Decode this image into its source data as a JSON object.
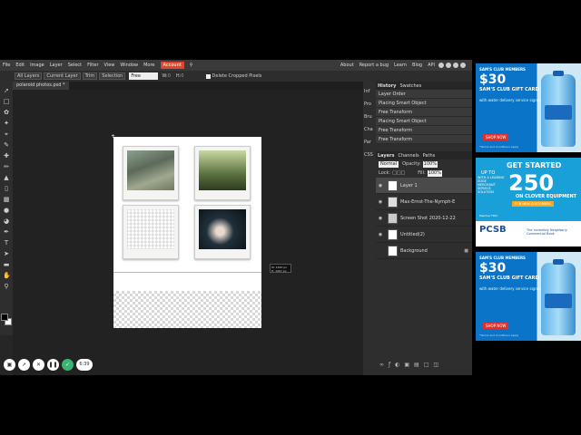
{
  "menu": {
    "items": [
      "File",
      "Edit",
      "Image",
      "Layer",
      "Select",
      "Filter",
      "View",
      "Window",
      "More"
    ],
    "account": "Account",
    "right_items": [
      "About",
      "Report a bug",
      "Learn",
      "Blog",
      "API"
    ]
  },
  "options": {
    "all_layers": "All Layers",
    "current_layer": "Current Layer",
    "trim": "Trim",
    "selection": "Selection",
    "mode": "Free",
    "w_label": "W:",
    "w_value": "0",
    "h_label": "H:",
    "h_value": "0",
    "delete_cropped": "Delete Cropped Pixels"
  },
  "document": {
    "tab_title": "polaroid photos.psd *",
    "tooltip_w": "W: 1640 px",
    "tooltip_h": "H: 1067 px"
  },
  "bottom": {
    "timer": "6:39"
  },
  "mini_panel": [
    "Inf",
    "Pro",
    "Bru",
    "Cha",
    "Par",
    "CSS"
  ],
  "history": {
    "tabs": [
      "History",
      "Swatches"
    ],
    "items": [
      "Layer Order",
      "Placing Smart Object",
      "Free Transform",
      "Placing Smart Object",
      "Free Transform",
      "Free Transform"
    ]
  },
  "layers": {
    "tabs": [
      "Layers",
      "Channels",
      "Paths"
    ],
    "blend_mode": "Normal",
    "opacity_label": "Opacity:",
    "opacity_value": "100%",
    "lock_label": "Lock:",
    "fill_label": "Fill:",
    "fill_value": "100%",
    "items": [
      "Layer 1",
      "Max-Ernst-The-Nymph-E",
      "Screen Shot 2020-12-22",
      "Untitled(2)",
      "Background"
    ]
  },
  "ads": {
    "sams1": {
      "brand": "SAM'S CLUB MEMBERS",
      "amount": "$30",
      "title": "SAM'S CLUB GIFT CARD",
      "sub": "with water delivery service signup!",
      "btn": "SHOP NOW",
      "fine": "*Terms and Conditions Apply"
    },
    "clover": {
      "headline": "GET STARTED",
      "up": "UP TO",
      "amount": "250",
      "side": "WITH A LEADING EDGE MERCHANT SERVICE SOLUTION",
      "on": "ON CLOVER EQUIPMENT",
      "cta": "FOR NEW CUSTOMERS",
      "member": "Member FDIC",
      "bank": "PCSB",
      "bank_sub": "The Incredibly Neighborly Commercial Bank"
    },
    "sams2": {
      "brand": "SAM'S CLUB MEMBERS",
      "amount": "$30",
      "title": "SAM'S CLUB GIFT CARD",
      "sub": "with water delivery service signup!",
      "btn": "SHOP NOW",
      "fine": "*Terms and Conditions Apply"
    }
  }
}
